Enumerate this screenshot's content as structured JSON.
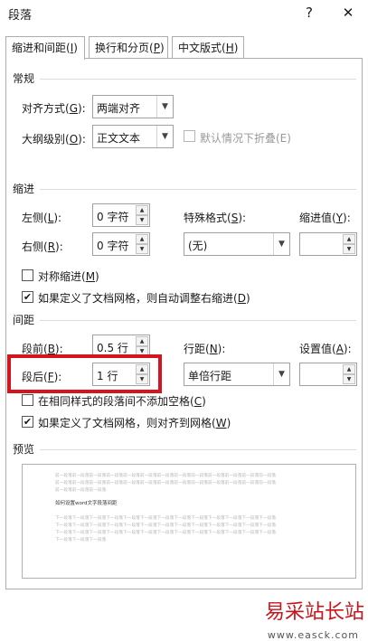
{
  "window": {
    "title": "段落",
    "help": "?",
    "close": "✕"
  },
  "tabs": [
    {
      "label": "缩进和间距(",
      "key": "I",
      "suffix": ")"
    },
    {
      "label": "换行和分页(",
      "key": "P",
      "suffix": ")"
    },
    {
      "label": "中文版式(",
      "key": "H",
      "suffix": ")"
    }
  ],
  "general": {
    "heading": "常规",
    "alignment_label": "对齐方式(",
    "alignment_key": "G",
    "alignment_suffix": "):",
    "alignment_value": "两端对齐",
    "outline_label": "大纲级别(",
    "outline_key": "O",
    "outline_suffix": "):",
    "outline_value": "正文文本",
    "collapse_label": "默认情况下折叠(E)"
  },
  "indent": {
    "heading": "缩进",
    "left_label": "左侧(",
    "left_key": "L",
    "left_suffix": "):",
    "left_value": "0 字符",
    "right_label": "右侧(",
    "right_key": "R",
    "right_suffix": "):",
    "right_value": "0 字符",
    "special_label": "特殊格式(",
    "special_key": "S",
    "special_suffix": "):",
    "special_value": "(无)",
    "by_label": "缩进值(",
    "by_key": "Y",
    "by_suffix": "):",
    "by_value": "",
    "mirror_label": "对称缩进(",
    "mirror_key": "M",
    "mirror_suffix": ")",
    "grid_label": "如果定义了文档网格，则自动调整右缩进(",
    "grid_key": "D",
    "grid_suffix": ")"
  },
  "spacing": {
    "heading": "间距",
    "before_label": "段前(",
    "before_key": "B",
    "before_suffix": "):",
    "before_value": "0.5 行",
    "after_label": "段后(",
    "after_key": "F",
    "after_suffix": "):",
    "after_value": "1 行",
    "line_label": "行距(",
    "line_key": "N",
    "line_suffix": "):",
    "line_value": "单倍行距",
    "at_label": "设置值(",
    "at_key": "A",
    "at_suffix": "):",
    "at_value": "",
    "no_space_label": "在相同样式的段落间不添加空格(",
    "no_space_key": "C",
    "no_space_suffix": ")",
    "snap_label": "如果定义了文档网格，则对齐到网格(",
    "snap_key": "W",
    "snap_suffix": ")"
  },
  "preview": {
    "heading": "预览",
    "prev_text": "前一段落前一段落前一段落前一段落前一段落前一段落前一段落前一段落前一段落前一段落前一段落前一段落前一段落",
    "prev_last": "前一段落前一段落前一段落",
    "sample": "如何设置word文字段落间距",
    "next_text": "下一段落下一段落下一段落下一段落下一段落下一段落下一段落下一段落下一段落下一段落下一段落下一段落下一段落",
    "next_last": "下一段落下一段落下一段落"
  },
  "watermark": {
    "brand": "易采站长站",
    "url": "www.easck.com"
  },
  "icons": {
    "check": "✔",
    "down": "▼",
    "up": "▲"
  }
}
